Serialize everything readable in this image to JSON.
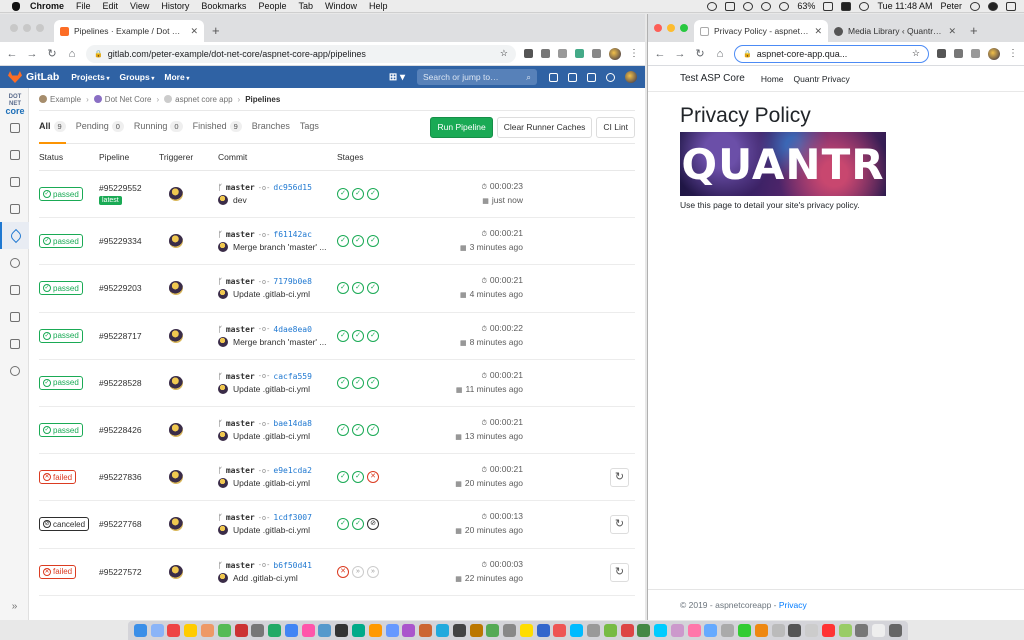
{
  "menubar": {
    "app": "Chrome",
    "items": [
      "File",
      "Edit",
      "View",
      "History",
      "Bookmarks",
      "People",
      "Tab",
      "Window",
      "Help"
    ],
    "battery": "63%",
    "clock": "Tue 11:48 AM",
    "user": "Peter"
  },
  "left_window": {
    "tab_title": "Pipelines · Example / Dot Net C",
    "url": "gitlab.com/peter-example/dot-net-core/aspnet-core-app/pipelines",
    "gitlab": {
      "logo_text": "GitLab",
      "nav": [
        "Projects",
        "Groups",
        "More"
      ],
      "search_placeholder": "Search or jump to…",
      "side_logo_small": "DOT NET",
      "side_logo": "core",
      "breadcrumb": [
        "Example",
        "Dot Net Core",
        "aspnet core app",
        "Pipelines"
      ],
      "tabs": [
        {
          "label": "All",
          "count": "9"
        },
        {
          "label": "Pending",
          "count": "0"
        },
        {
          "label": "Running",
          "count": "0"
        },
        {
          "label": "Finished",
          "count": "9"
        },
        {
          "label": "Branches",
          "count": ""
        },
        {
          "label": "Tags",
          "count": ""
        }
      ],
      "buttons": {
        "run": "Run Pipeline",
        "clear": "Clear Runner Caches",
        "lint": "CI Lint"
      },
      "columns": [
        "Status",
        "Pipeline",
        "Triggerer",
        "Commit",
        "Stages"
      ],
      "pipelines": [
        {
          "status": "passed",
          "id": "#95229552",
          "latest": "latest",
          "branch": "master",
          "sha": "dc956d15",
          "msg": "dev",
          "stages": [
            "s",
            "s",
            "s"
          ],
          "duration": "00:00:23",
          "finished": "just now",
          "retry": false
        },
        {
          "status": "passed",
          "id": "#95229334",
          "latest": "",
          "branch": "master",
          "sha": "f61142ac",
          "msg": "Merge branch 'master' ...",
          "stages": [
            "s",
            "s",
            "s"
          ],
          "duration": "00:00:21",
          "finished": "3 minutes ago",
          "retry": false
        },
        {
          "status": "passed",
          "id": "#95229203",
          "latest": "",
          "branch": "master",
          "sha": "7179b0e8",
          "msg": "Update .gitlab-ci.yml",
          "stages": [
            "s",
            "s",
            "s"
          ],
          "duration": "00:00:21",
          "finished": "4 minutes ago",
          "retry": false
        },
        {
          "status": "passed",
          "id": "#95228717",
          "latest": "",
          "branch": "master",
          "sha": "4dae8ea0",
          "msg": "Merge branch 'master' ...",
          "stages": [
            "s",
            "s",
            "s"
          ],
          "duration": "00:00:22",
          "finished": "8 minutes ago",
          "retry": false
        },
        {
          "status": "passed",
          "id": "#95228528",
          "latest": "",
          "branch": "master",
          "sha": "cacfa559",
          "msg": "Update .gitlab-ci.yml",
          "stages": [
            "s",
            "s",
            "s"
          ],
          "duration": "00:00:21",
          "finished": "11 minutes ago",
          "retry": false
        },
        {
          "status": "passed",
          "id": "#95228426",
          "latest": "",
          "branch": "master",
          "sha": "bae14da8",
          "msg": "Update .gitlab-ci.yml",
          "stages": [
            "s",
            "s",
            "s"
          ],
          "duration": "00:00:21",
          "finished": "13 minutes ago",
          "retry": false
        },
        {
          "status": "failed",
          "id": "#95227836",
          "latest": "",
          "branch": "master",
          "sha": "e9e1cda2",
          "msg": "Update .gitlab-ci.yml",
          "stages": [
            "s",
            "s",
            "f"
          ],
          "duration": "00:00:21",
          "finished": "20 minutes ago",
          "retry": true
        },
        {
          "status": "canceled",
          "id": "#95227768",
          "latest": "",
          "branch": "master",
          "sha": "1cdf3007",
          "msg": "Update .gitlab-ci.yml",
          "stages": [
            "s",
            "s",
            "c"
          ],
          "duration": "00:00:13",
          "finished": "20 minutes ago",
          "retry": true
        },
        {
          "status": "failed",
          "id": "#95227572",
          "latest": "",
          "branch": "master",
          "sha": "b6f50d41",
          "msg": "Add .gitlab-ci.yml",
          "stages": [
            "f",
            "k",
            "k"
          ],
          "duration": "00:00:03",
          "finished": "22 minutes ago",
          "retry": true
        }
      ]
    }
  },
  "right_window": {
    "tab1_title": "Privacy Policy - aspnetcoreapp",
    "tab2_title": "Media Library ‹ Quantr — Wo",
    "url": "aspnet-core-app.qua...",
    "app": {
      "brand": "Test ASP Core",
      "nav": [
        "Home",
        "Quantr Privacy"
      ],
      "title": "Privacy Policy",
      "logo_text": "QUANTR",
      "body": "Use this page to detail your site's privacy policy.",
      "footer_text": "© 2019 - aspnetcoreapp - ",
      "footer_link": "Privacy"
    }
  },
  "colors": {
    "passed": "#1aaa55",
    "failed": "#db3b21",
    "gitlab_header": "#2f62a4",
    "run_button": "#1aaa55"
  }
}
